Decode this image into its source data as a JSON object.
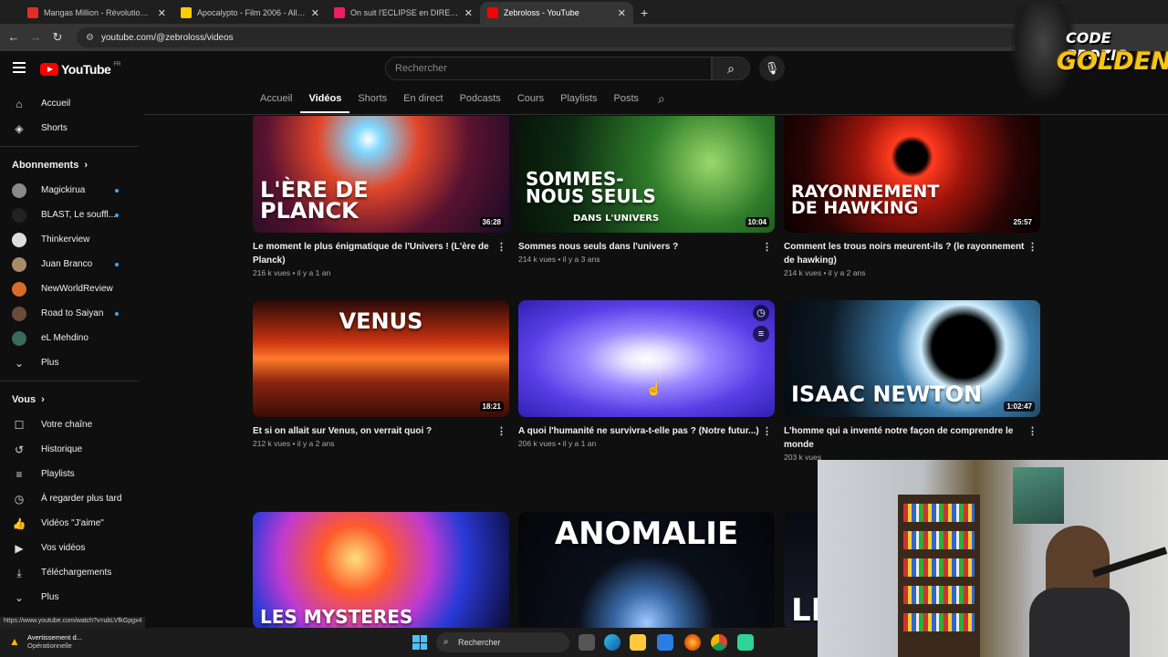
{
  "browser": {
    "tabs": [
      {
        "title": "Mangas Million - Révolution de",
        "color": "#e52d27"
      },
      {
        "title": "Apocalypto - Film 2006 - AlloC",
        "color": "#fecc00"
      },
      {
        "title": "On suit l'ECLIPSE en DIRECT de",
        "color": "#e91e63"
      },
      {
        "title": "Zebroloss - YouTube",
        "color": "#ff0000"
      }
    ],
    "url": "youtube.com/@zebroloss/videos",
    "status_url": "https://www.youtube.com/watch?v=ubLVfkGpgx4"
  },
  "youtube": {
    "logo_text": "YouTube",
    "logo_region": "FR",
    "search_placeholder": "Rechercher"
  },
  "channel_tabs": [
    "Accueil",
    "Vidéos",
    "Shorts",
    "En direct",
    "Podcasts",
    "Cours",
    "Playlists",
    "Posts"
  ],
  "sidebar": {
    "main": [
      {
        "label": "Accueil",
        "icon": "home-icon",
        "glyph": "⌂"
      },
      {
        "label": "Shorts",
        "icon": "shorts-icon",
        "glyph": "◈"
      }
    ],
    "subscriptions_heading": "Abonnements",
    "subscriptions": [
      {
        "label": "Magickirua",
        "color": "#8a8a8a",
        "dot": true
      },
      {
        "label": "BLAST, Le souffl...",
        "color": "#222222",
        "dot": true
      },
      {
        "label": "Thinkerview",
        "color": "#dddddd",
        "dot": false
      },
      {
        "label": "Juan Branco",
        "color": "#a58a6b",
        "dot": true
      },
      {
        "label": "NewWorldReview",
        "color": "#d86c2a",
        "dot": false
      },
      {
        "label": "Road to Saiyan",
        "color": "#6a4c3a",
        "dot": true
      },
      {
        "label": "eL Mehdino",
        "color": "#3a6a5a",
        "dot": false
      }
    ],
    "subs_more": "Plus",
    "you_heading": "Vous",
    "you": [
      {
        "label": "Votre chaîne",
        "icon": "channel-icon",
        "glyph": "☐"
      },
      {
        "label": "Historique",
        "icon": "history-icon",
        "glyph": "↺"
      },
      {
        "label": "Playlists",
        "icon": "playlists-icon",
        "glyph": "≡"
      },
      {
        "label": "À regarder plus tard",
        "icon": "watch-later-icon",
        "glyph": "◷"
      },
      {
        "label": "Vidéos \"J'aime\"",
        "icon": "like-icon",
        "glyph": "👍"
      },
      {
        "label": "Vos vidéos",
        "icon": "your-videos-icon",
        "glyph": "▶"
      },
      {
        "label": "Téléchargements",
        "icon": "download-icon",
        "glyph": "⤓"
      },
      {
        "label": "Plus",
        "icon": "chevron-down-icon",
        "glyph": "⌄"
      }
    ]
  },
  "videos": [
    {
      "thumb_text": "L'ÈRE DE PLANCK",
      "duration": "36:28",
      "title": "Le moment le plus énigmatique de l'Univers ! (L'ère de Planck)",
      "meta": "216 k vues • il y a 1 an",
      "bg": "radial-gradient(circle at 45% 20%, #fff 0%, #7fd7ff 8%, #e2462a 30%, #5a1330 60%, #160a24 100%)"
    },
    {
      "thumb_text": "SOMMES-NOUS SEULS",
      "thumb_sub": "DANS L'UNIVERS",
      "duration": "10:04",
      "title": "Sommes nous seuls dans l'univers ?",
      "meta": "214 k vues • il y a 3 ans",
      "bg": "radial-gradient(circle at 75% 40%, #9bd86a 0%, #2f7d2a 30%, #0d2b12 70%, #071207 100%)"
    },
    {
      "thumb_text": "RAYONNEMENT DE HAWKING",
      "duration": "25:57",
      "title": "Comment les trous noirs meurent-ils ? (le rayonnement de hawking)",
      "meta": "214 k vues • il y a 2 ans",
      "bg": "radial-gradient(circle at 50% 35%, #000 0%, #000 10%, #ff3b1f 14%, #a0150c 35%, #2a0505 70%, #0a0000 100%)"
    },
    {
      "thumb_text": "VENUS",
      "duration": "18:21",
      "title": "Et si on allait sur Venus, on verrait quoi ?",
      "meta": "212 k vues • il y a 2 ans",
      "bg": "linear-gradient(180deg, #2a0a08 0%, #c6320f 35%, #ff7a2a 50%, #8a2410 70%, #3a0d07 100%)"
    },
    {
      "thumb_text": "",
      "duration": "",
      "title": "A quoi l'humanité ne survivra-t-elle pas ? (Notre futur...)",
      "meta": "206 k vues • il y a 1 an",
      "bg": "radial-gradient(ellipse at 50% 50%, #fff 0%, #e8e4ff 12%, #9a86ff 35%, #5a3ee6 65%, #3020b0 100%)"
    },
    {
      "thumb_text": "ISAAC NEWTON",
      "duration": "1:02:47",
      "title": "L'homme qui a inventé notre façon de comprendre le monde",
      "meta": "203 k vues",
      "bg": "radial-gradient(circle at 70% 40%, #000 0%, #000 16%, #cfefff 22%, #3a7aa8 35%, #0d1a26 70%, #050a10 100%)"
    },
    {
      "thumb_text": "LES MYSTERES",
      "duration": "",
      "title": "",
      "meta": "",
      "bg": "radial-gradient(circle at 40% 40%, #ffe07a 0%, #ff5a2a 20%, #c03ad0 45%, #2a3ad8 65%, #0a0a30 100%)"
    },
    {
      "thumb_text": "ANOMALIE",
      "duration": "",
      "title": "",
      "meta": "",
      "bg": "radial-gradient(circle at 50% 95%, #9ec8ff 0%, #3a6aa8 18%, #0a0f1a 40%, #050508 100%)"
    },
    {
      "thumb_text": "LE",
      "duration": "",
      "title": "",
      "meta": "",
      "bg": "linear-gradient(180deg, #0a0a14, #1a1a2a)"
    }
  ],
  "overlay": {
    "line1": "CODE PROZIS",
    "line2": "GOLDENG"
  },
  "taskbar": {
    "warning_title": "Avertissement d...",
    "warning_sub": "Opérationnelle",
    "search": "Rechercher"
  }
}
